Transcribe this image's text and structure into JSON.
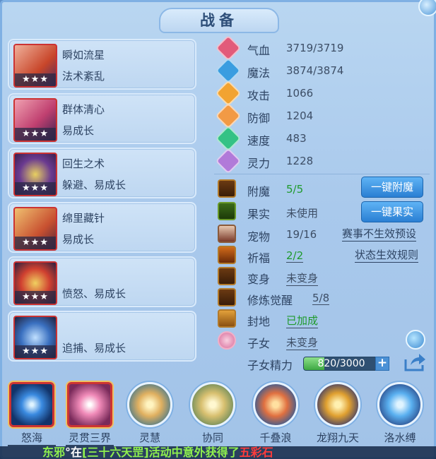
{
  "title": "战备",
  "skills": [
    {
      "name": "瞬如流星",
      "effect": "法术紊乱",
      "stars": "★★★"
    },
    {
      "name": "群体清心",
      "effect": "易成长",
      "stars": "★★★"
    },
    {
      "name": "回生之术",
      "effect": "躲避、易成长",
      "stars": "★★★"
    },
    {
      "name": "绵里藏针",
      "effect": "易成长",
      "stars": "★★★"
    },
    {
      "name": "",
      "effect": "愤怒、易成长",
      "stars": "★★★"
    },
    {
      "name": "",
      "effect": "追捕、易成长",
      "stars": "★★★"
    }
  ],
  "stats": [
    {
      "label": "气血",
      "value": "3719/3719",
      "color": "#e25b7a",
      "icon": "heart-icon"
    },
    {
      "label": "魔法",
      "value": "3874/3874",
      "color": "#3a9de0",
      "icon": "mana-icon"
    },
    {
      "label": "攻击",
      "value": "1066",
      "color": "#f2a331",
      "icon": "sword-icon"
    },
    {
      "label": "防御",
      "value": "1204",
      "color": "#f29a45",
      "icon": "shield-icon"
    },
    {
      "label": "速度",
      "value": "483",
      "color": "#34c285",
      "icon": "lightning-icon"
    },
    {
      "label": "灵力",
      "value": "1228",
      "color": "#b17ad9",
      "icon": "spirit-icon"
    }
  ],
  "info": {
    "fumo": {
      "label": "附魔",
      "value": "5/5"
    },
    "guoshi": {
      "label": "果实",
      "value": "未使用"
    },
    "chongwu": {
      "label": "宠物",
      "value": "19/16"
    },
    "qifu": {
      "label": "祈福",
      "value": "2/2"
    },
    "bianshen": {
      "label": "变身",
      "value": "未变身"
    },
    "xiulian": {
      "label": "修炼觉醒",
      "value": "5/8"
    },
    "fengdi": {
      "label": "封地",
      "value": "已加成"
    },
    "zinv": {
      "label": "子女",
      "value": "未变身"
    },
    "zinv_energy": {
      "label": "子女精力",
      "value": "820/3000",
      "fraction": 0.273
    }
  },
  "buttons": {
    "one_key_fumo": "一键附魔",
    "one_key_guoshi": "一键果实"
  },
  "links": {
    "saishi": "赛事不生效预设",
    "zhuangtai": "状态生效规则"
  },
  "bottom_skills": [
    {
      "label": "怒海"
    },
    {
      "label": "灵贯三界"
    },
    {
      "label": "灵慧"
    },
    {
      "label": "协同"
    },
    {
      "label": "千叠浪"
    },
    {
      "label": "龙翔九天"
    },
    {
      "label": "洛水缚"
    }
  ],
  "ticker": {
    "prefix": "东邪",
    "white": "°在",
    "middle": "[三十六天罡]活动中意外获得了",
    "highlight": "五彩石"
  }
}
